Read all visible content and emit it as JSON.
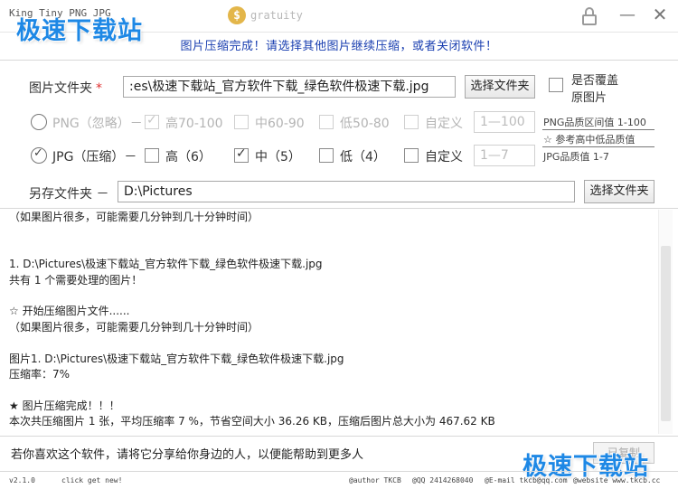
{
  "titlebar": {
    "app_title": "King Tiny PNG JPG",
    "gratuity_symbol": "$",
    "gratuity_label": "gratuity",
    "minimize_label": "—",
    "close_label": "✕"
  },
  "watermark": {
    "text": "极速下载站"
  },
  "status_message": "图片压缩完成！请选择其他图片继续压缩，或者关闭软件！",
  "file": {
    "label": "图片文件夹",
    "required_mark": "*",
    "value": ":es\\极速下载站_官方软件下载_绿色软件极速下载.jpg",
    "browse_label": "选择文件夹",
    "overwrite_label_line1": "是否覆盖",
    "overwrite_label_line2": "原图片",
    "overwrite_checked": false
  },
  "png": {
    "label": "PNG（忽略）－",
    "selected": false,
    "options": [
      {
        "label": "高70-100",
        "checked": true
      },
      {
        "label": "中60-90",
        "checked": false
      },
      {
        "label": "低50-80",
        "checked": false
      },
      {
        "label": "自定义",
        "checked": false
      }
    ],
    "custom_value": "1—100",
    "range_note": "PNG品质区间值 1-100"
  },
  "hint": "☆ 参考高中低品质值",
  "jpg": {
    "label": "JPG（压缩）－",
    "selected": true,
    "options": [
      {
        "label": "高（6）",
        "checked": false
      },
      {
        "label": "中（5）",
        "checked": true
      },
      {
        "label": "低（4）",
        "checked": false
      },
      {
        "label": "自定义",
        "checked": false
      }
    ],
    "custom_value": "1—7",
    "range_note": "JPG品质值 1-7"
  },
  "output": {
    "label": "另存文件夹 －",
    "value": "D:\\Pictures",
    "browse_label": "选择文件夹"
  },
  "log": [
    "（如果图片很多，可能需要几分钟到几十分钟时间）",
    "",
    "",
    "1. D:\\Pictures\\极速下载站_官方软件下载_绿色软件极速下载.jpg",
    "共有 1 个需要处理的图片！",
    "",
    "☆ 开始压缩图片文件......",
    "（如果图片很多，可能需要几分钟到几十分钟时间）",
    "",
    "图片1. D:\\Pictures\\极速下载站_官方软件下载_绿色软件极速下载.jpg",
    "压缩率：7%",
    "",
    "★ 图片压缩完成！！！",
    "本次共压缩图片 1 张，平均压缩率 7 %，节省空间大小 36.26 KB，压缩后图片总大小为 467.62 KB"
  ],
  "footer": {
    "share_message": "若你喜欢这个软件，请将它分享给你身边的人，以便能帮助到更多人",
    "share_button": "已复制"
  },
  "statusbar": {
    "version": "v2.1.0",
    "check": "click get new!",
    "author": "@author TKCB",
    "qq": "@QQ 2414268040",
    "email": "@E-mail tkcb@qq.com",
    "website": "@website www.tkcb.cc"
  }
}
